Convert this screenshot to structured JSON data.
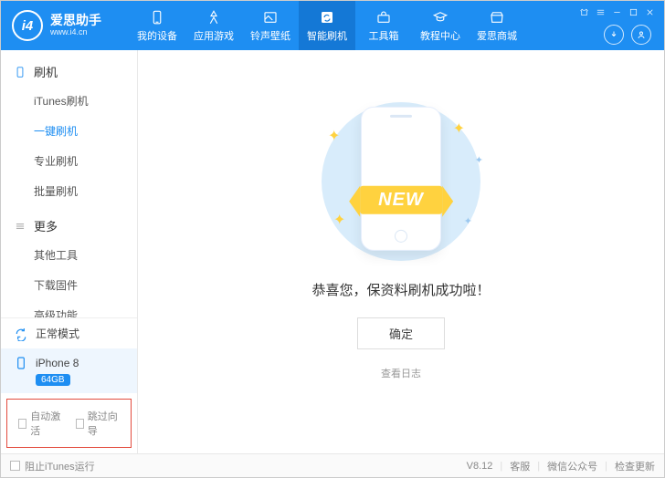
{
  "app": {
    "logo_badge": "i4",
    "title": "爱思助手",
    "subtitle": "www.i4.cn"
  },
  "nav": [
    {
      "id": "device",
      "label": "我的设备"
    },
    {
      "id": "games",
      "label": "应用游戏"
    },
    {
      "id": "ring",
      "label": "铃声壁纸"
    },
    {
      "id": "flash",
      "label": "智能刷机",
      "active": true
    },
    {
      "id": "toolbox",
      "label": "工具箱"
    },
    {
      "id": "tutorial",
      "label": "教程中心"
    },
    {
      "id": "mall",
      "label": "爱思商城"
    }
  ],
  "sidebar": {
    "group1_title": "刷机",
    "group1_items": [
      {
        "label": "iTunes刷机"
      },
      {
        "label": "一键刷机",
        "active": true
      },
      {
        "label": "专业刷机"
      },
      {
        "label": "批量刷机"
      }
    ],
    "group2_title": "更多",
    "group2_items": [
      {
        "label": "其他工具"
      },
      {
        "label": "下载固件"
      },
      {
        "label": "高级功能"
      }
    ],
    "mode_label": "正常模式",
    "device_name": "iPhone 8",
    "device_badge": "64GB",
    "cb_auto_activate": "自动激活",
    "cb_skip_wizard": "跳过向导"
  },
  "main": {
    "banner_text": "NEW",
    "message": "恭喜您，保资料刷机成功啦！",
    "confirm_label": "确定",
    "view_log_label": "查看日志"
  },
  "footer": {
    "block_itunes": "阻止iTunes运行",
    "version": "V8.12",
    "svc": "客服",
    "wechat": "微信公众号",
    "check_update": "检查更新"
  }
}
